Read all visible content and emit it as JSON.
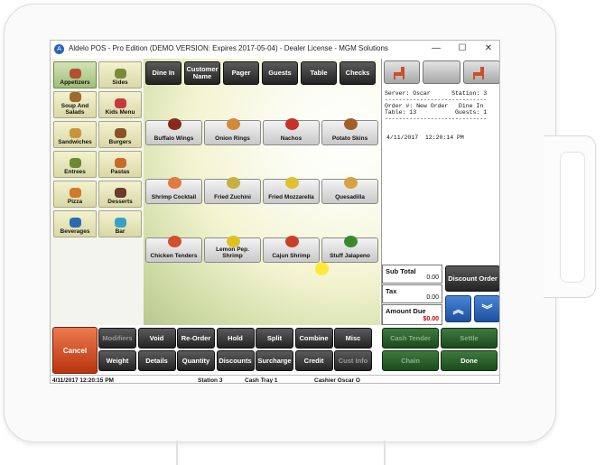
{
  "window": {
    "title": "Aldelo POS - Pro Edition (DEMO VERSION: Expires 2017-05-04) - Dealer License - MGM Solutions",
    "minimize": "—",
    "maximize": "☐",
    "close": "✕",
    "app_icon": "A"
  },
  "categories": [
    {
      "label": "Appetizers",
      "icon": "appetizers-icon",
      "color": "#b5502e",
      "selected": true
    },
    {
      "label": "Sides",
      "icon": "sides-icon",
      "color": "#7a8a3a",
      "selected": false
    },
    {
      "label": "Soup And Salads",
      "icon": "soup-icon",
      "color": "#a06a2c",
      "selected": false
    },
    {
      "label": "Kids Menu",
      "icon": "kids-menu-icon",
      "color": "#c83a3a",
      "selected": false
    },
    {
      "label": "Sandwiches",
      "icon": "sandwich-icon",
      "color": "#c8953a",
      "selected": false
    },
    {
      "label": "Burgers",
      "icon": "burger-icon",
      "color": "#8a5228",
      "selected": false
    },
    {
      "label": "Entrees",
      "icon": "entree-icon",
      "color": "#6c8a32",
      "selected": false
    },
    {
      "label": "Pastas",
      "icon": "pasta-icon",
      "color": "#c86a2a",
      "selected": false
    },
    {
      "label": "Pizza",
      "icon": "pizza-icon",
      "color": "#d07a2a",
      "selected": false
    },
    {
      "label": "Desserts",
      "icon": "dessert-icon",
      "color": "#6a3a2a",
      "selected": false
    },
    {
      "label": "Beverages",
      "icon": "beverage-icon",
      "color": "#2a6ab0",
      "selected": false
    },
    {
      "label": "Bar",
      "icon": "cocktail-icon",
      "color": "#3aa0c8",
      "selected": false
    }
  ],
  "tabs": [
    "Dine In",
    "Customer Name",
    "Pager",
    "Guests",
    "Table",
    "Checks"
  ],
  "items": [
    {
      "label": "Buffalo Wings",
      "icon": "buffalo-wings-icon",
      "color": "#8a2a1a"
    },
    {
      "label": "Onion Rings",
      "icon": "onion-rings-icon",
      "color": "#d08a3a"
    },
    {
      "label": "Nachos",
      "icon": "nachos-icon",
      "color": "#c8302a"
    },
    {
      "label": "Potato Skins",
      "icon": "potato-skins-icon",
      "color": "#a0602a"
    },
    {
      "label": "Shrimp Cocktail",
      "icon": "shrimp-cocktail-icon",
      "color": "#e07a40"
    },
    {
      "label": "Fried Zuchini",
      "icon": "zuchini-icon",
      "color": "#c8b040"
    },
    {
      "label": "Fried Mozzarella",
      "icon": "mozzarella-icon",
      "color": "#e0c030"
    },
    {
      "label": "Quesadilla",
      "icon": "quesadilla-icon",
      "color": "#d8a040"
    },
    {
      "label": "Chicken Tenders",
      "icon": "chicken-icon",
      "color": "#d05030"
    },
    {
      "label": "Lemon Pep. Shrimp",
      "icon": "lemon-shrimp-icon",
      "color": "#e0c020"
    },
    {
      "label": "Cajun Shrimp",
      "icon": "cajun-shrimp-icon",
      "color": "#c8402a"
    },
    {
      "label": "Stuff Jalapeno",
      "icon": "jalapeno-icon",
      "color": "#3a8a2a"
    }
  ],
  "receipt": {
    "line1": "Server: Oscar      Station: 3",
    "sep1": "-----------------------------",
    "line2": "Order #: New Order   Dine In",
    "line3": "Table: 13           Guests: 1",
    "sep2": "-----------------------------",
    "timestamp": "4/11/2017  12:20:14 PM"
  },
  "totals": {
    "subtotal_label": "Sub Total",
    "subtotal_value": "0.00",
    "tax_label": "Tax",
    "tax_value": "0.00",
    "amount_due_label": "Amount Due",
    "amount_due_value": "$0.00"
  },
  "discount_label": "Discount Order",
  "arrows": {
    "up": "︽",
    "down": "︾"
  },
  "cancel_label": "Cancel",
  "row1": [
    "Modifiers",
    "Void",
    "Re-Order",
    "Hold",
    "Split",
    "Combine",
    "Misc"
  ],
  "row1_disabled": [
    true,
    false,
    false,
    false,
    false,
    false,
    false
  ],
  "row2": [
    "Weight",
    "Details",
    "Quantity",
    "Discounts",
    "Surcharge",
    "Credit",
    "Cust Info"
  ],
  "row2_disabled": [
    false,
    false,
    false,
    false,
    false,
    false,
    true
  ],
  "green_row1": [
    "Cash Tender",
    "Settle"
  ],
  "green_row2": [
    "Chain",
    "Done"
  ],
  "green_disabled": [
    true,
    true,
    true,
    false
  ],
  "status": {
    "datetime": "4/11/2017 12:20:15 PM",
    "station": "Station 3",
    "cash_tray": "Cash Tray 1",
    "cashier": "Cashier Oscar O"
  }
}
